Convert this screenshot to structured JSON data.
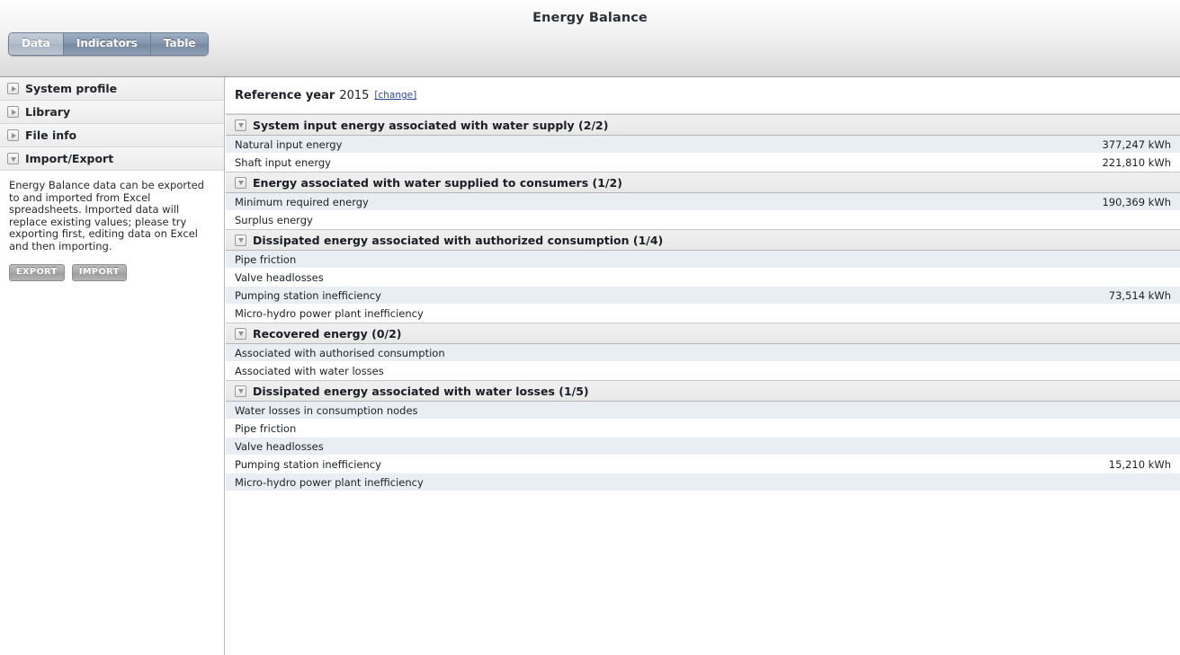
{
  "window": {
    "title": "Energy Balance"
  },
  "tabs": [
    {
      "label": "Data",
      "selected": true
    },
    {
      "label": "Indicators",
      "selected": false
    },
    {
      "label": "Table",
      "selected": false
    }
  ],
  "sidebar": {
    "items": [
      {
        "label": "System profile",
        "expanded": false
      },
      {
        "label": "Library",
        "expanded": false
      },
      {
        "label": "File info",
        "expanded": false
      },
      {
        "label": "Import/Export",
        "expanded": true
      }
    ],
    "panel": {
      "description": "Energy Balance data can be exported to and imported from Excel spreadsheets. Imported data will replace existing values; please try exporting first, editing data on Excel and then importing.",
      "export_label": "EXPORT",
      "import_label": "IMPORT"
    }
  },
  "content": {
    "reference": {
      "label": "Reference year",
      "year": "2015",
      "change_link": "[change]"
    },
    "groups": [
      {
        "title": "System input energy associated with water supply (2/2)",
        "expanded": true,
        "rows": [
          {
            "label": "Natural input energy",
            "value": "377,247 kWh"
          },
          {
            "label": "Shaft input energy",
            "value": "221,810 kWh"
          }
        ]
      },
      {
        "title": "Energy associated with water supplied to consumers (1/2)",
        "expanded": true,
        "rows": [
          {
            "label": "Minimum required energy",
            "value": "190,369 kWh"
          },
          {
            "label": "Surplus energy",
            "value": ""
          }
        ]
      },
      {
        "title": "Dissipated energy associated with authorized consumption (1/4)",
        "expanded": true,
        "rows": [
          {
            "label": "Pipe friction",
            "value": ""
          },
          {
            "label": "Valve headlosses",
            "value": ""
          },
          {
            "label": "Pumping station inefficiency",
            "value": "73,514 kWh"
          },
          {
            "label": "Micro-hydro power plant inefficiency",
            "value": ""
          }
        ]
      },
      {
        "title": "Recovered energy (0/2)",
        "expanded": true,
        "rows": [
          {
            "label": "Associated with authorised consumption",
            "value": ""
          },
          {
            "label": "Associated with water losses",
            "value": ""
          }
        ]
      },
      {
        "title": "Dissipated energy associated with water losses (1/5)",
        "expanded": true,
        "rows": [
          {
            "label": "Water losses in consumption nodes",
            "value": ""
          },
          {
            "label": "Pipe friction",
            "value": ""
          },
          {
            "label": "Valve headlosses",
            "value": ""
          },
          {
            "label": "Pumping station inefficiency",
            "value": "15,210 kWh"
          },
          {
            "label": "Micro-hydro power plant inefficiency",
            "value": ""
          }
        ]
      }
    ]
  }
}
